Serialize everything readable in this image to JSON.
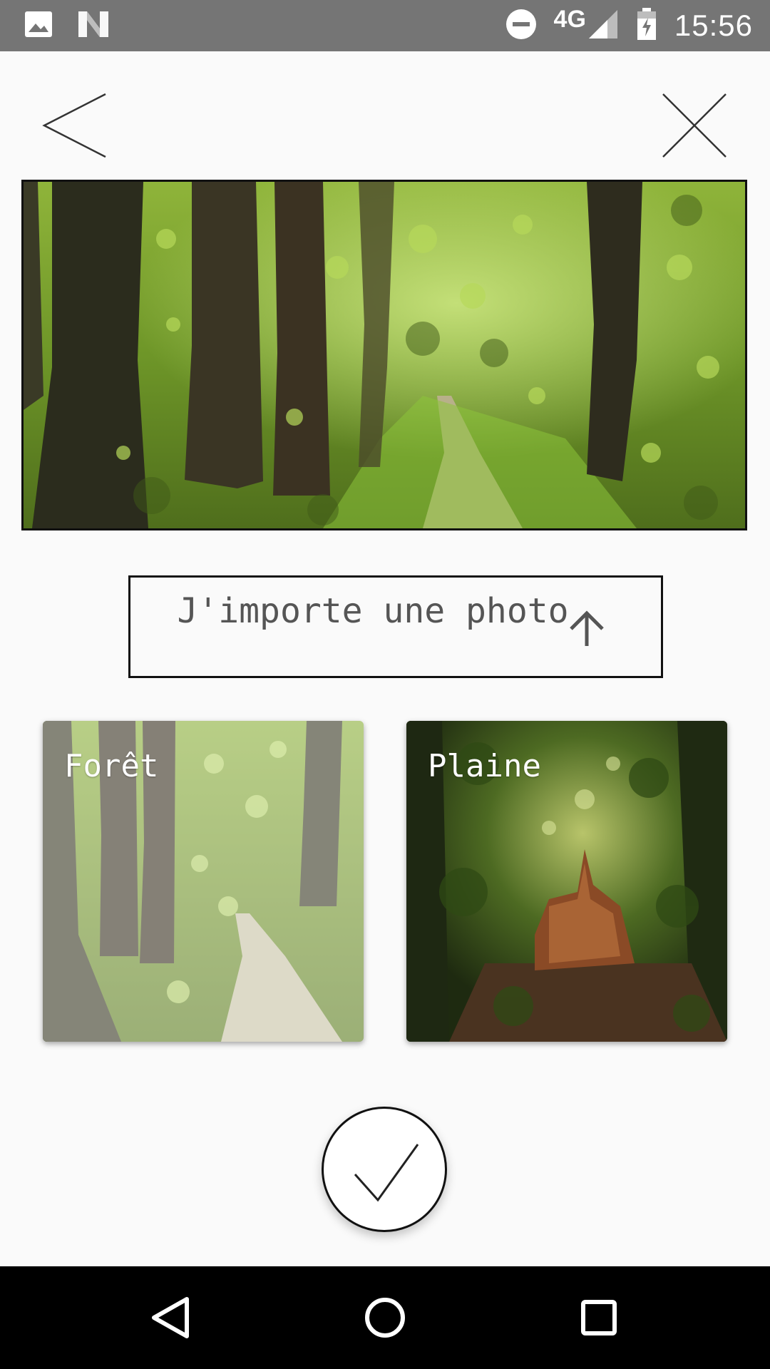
{
  "status_bar": {
    "time": "15:56",
    "network": "4G",
    "icons": [
      "image-notification-icon",
      "n-notification-icon",
      "do-not-disturb-icon",
      "signal-icon",
      "battery-charging-icon"
    ]
  },
  "toolbar": {
    "back_icon": "chevron-left-icon",
    "close_icon": "close-icon"
  },
  "import_button": {
    "label": "J'importe une photo",
    "icon": "arrow-up-icon"
  },
  "cards": [
    {
      "label": "Forêt",
      "selected": false
    },
    {
      "label": "Plaine",
      "selected": true
    }
  ],
  "confirm_button": {
    "icon": "check-icon"
  },
  "nav_bar": {
    "icons": [
      "nav-back-icon",
      "nav-home-icon",
      "nav-recents-icon"
    ]
  }
}
